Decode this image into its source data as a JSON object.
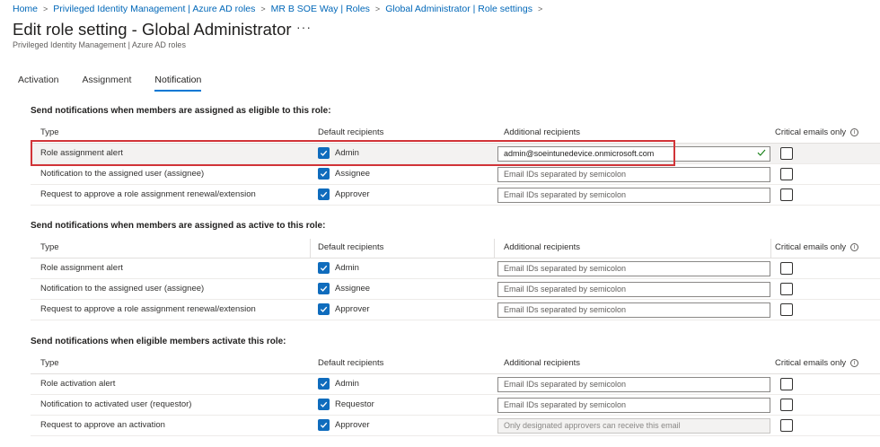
{
  "breadcrumb": [
    "Home",
    "Privileged Identity Management | Azure AD roles",
    "MR B SOE Way | Roles",
    "Global Administrator | Role settings"
  ],
  "page": {
    "title": "Edit role setting - Global Administrator",
    "subtitle": "Privileged Identity Management | Azure AD roles",
    "more": "···"
  },
  "tabs": [
    "Activation",
    "Assignment",
    "Notification"
  ],
  "active_tab": "Notification",
  "columns": {
    "type": "Type",
    "default": "Default recipients",
    "additional": "Additional recipients",
    "critical": "Critical emails only"
  },
  "sections": [
    {
      "title": "Send notifications when members are assigned as eligible to this role:",
      "rows": [
        {
          "type": "Role assignment alert",
          "recipient": "Admin",
          "additional": "admin@soeintunedevice.onmicrosoft.com"
        },
        {
          "type": "Notification to the assigned user (assignee)",
          "recipient": "Assignee",
          "additional": "Email IDs separated by semicolon"
        },
        {
          "type": "Request to approve a role assignment renewal/extension",
          "recipient": "Approver",
          "additional": "Email IDs separated by semicolon"
        }
      ]
    },
    {
      "title": "Send notifications when members are assigned as active to this role:",
      "rows": [
        {
          "type": "Role assignment alert",
          "recipient": "Admin",
          "additional": "Email IDs separated by semicolon"
        },
        {
          "type": "Notification to the assigned user (assignee)",
          "recipient": "Assignee",
          "additional": "Email IDs separated by semicolon"
        },
        {
          "type": "Request to approve a role assignment renewal/extension",
          "recipient": "Approver",
          "additional": "Email IDs separated by semicolon"
        }
      ]
    },
    {
      "title": "Send notifications when eligible members activate this role:",
      "rows": [
        {
          "type": "Role activation alert",
          "recipient": "Admin",
          "additional": "Email IDs separated by semicolon"
        },
        {
          "type": "Notification to activated user (requestor)",
          "recipient": "Requestor",
          "additional": "Email IDs separated by semicolon"
        },
        {
          "type": "Request to approve an activation",
          "recipient": "Approver",
          "additional": "Only designated approvers can receive this email"
        }
      ]
    }
  ],
  "colors": {
    "accent": "#0f6cbd",
    "highlight": "#d13438",
    "link": "#0067b8"
  }
}
